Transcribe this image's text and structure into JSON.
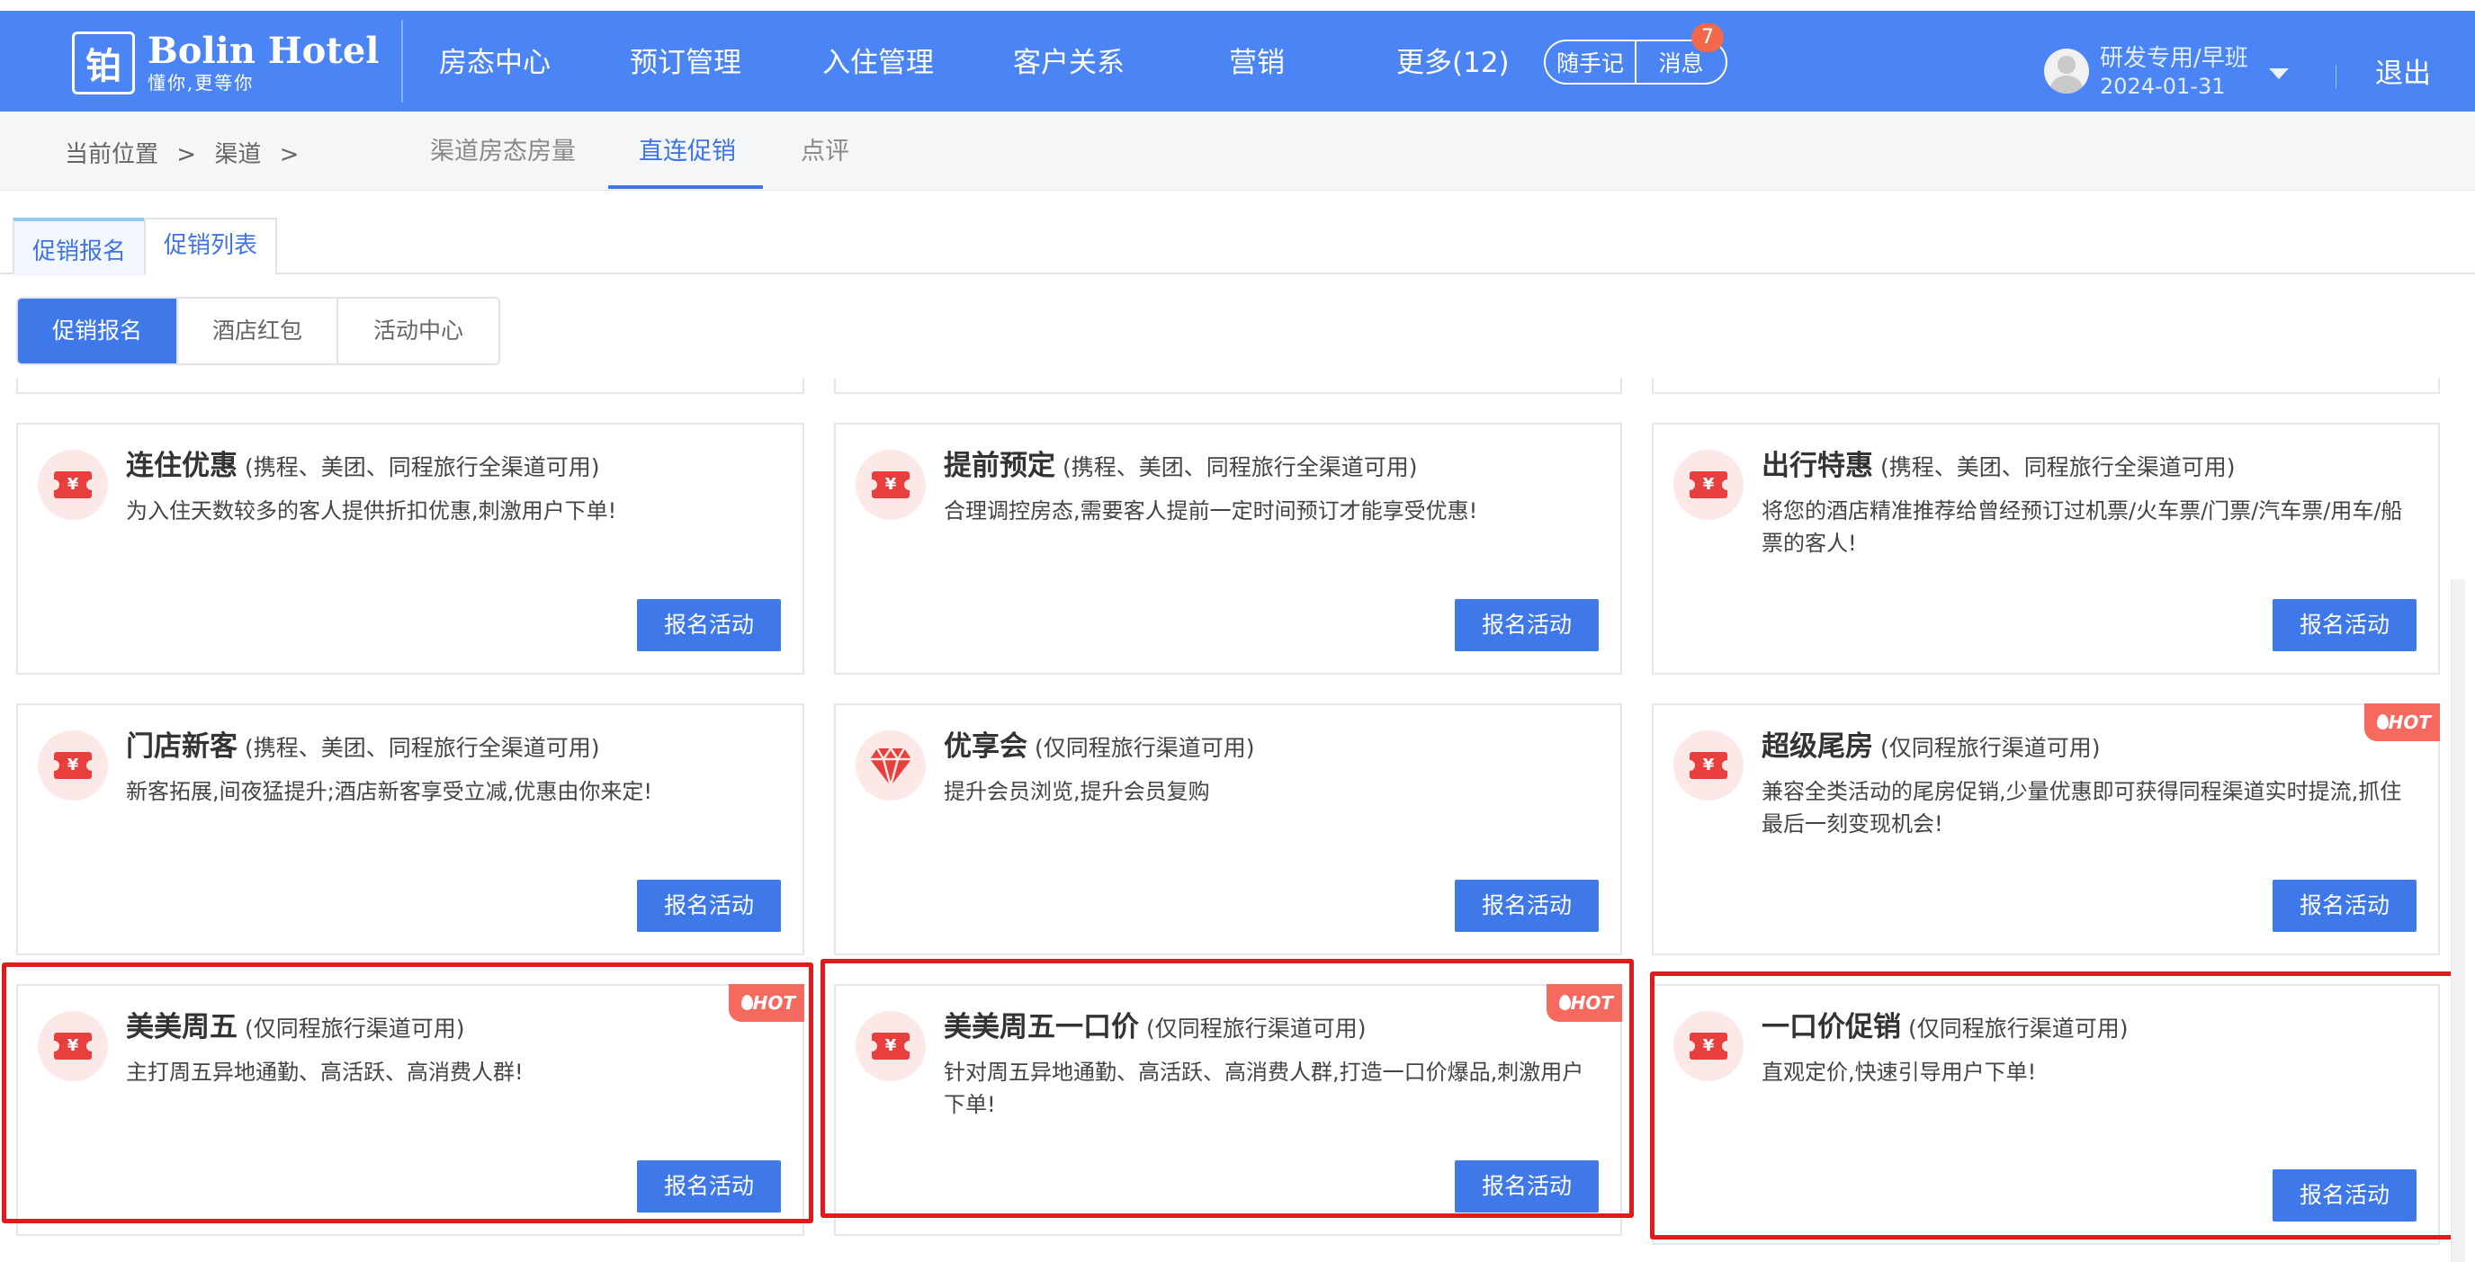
{
  "header": {
    "logo_mark": "铂",
    "logo_name": "Bolin Hotel",
    "logo_slogan": "懂你,更等你",
    "nav": [
      "房态中心",
      "预订管理",
      "入住管理",
      "客户关系",
      "营销",
      "更多(12)"
    ],
    "notes_label": "随手记",
    "messages_label": "消息",
    "messages_count": "7",
    "user_name": "研发专用/早班",
    "user_date": "2024-01-31",
    "logout_label": "退出"
  },
  "breadcrumb": [
    "当前位置",
    ">",
    "渠道",
    ">"
  ],
  "subtabs": [
    "渠道房态房量",
    "直连促销",
    "点评"
  ],
  "promo_tabs": [
    "促销报名",
    "促销列表"
  ],
  "segments": [
    "促销报名",
    "酒店红包",
    "活动中心"
  ],
  "cards": [
    {
      "title": "连住优惠",
      "scope": "(携程、美团、同程旅行全渠道可用)",
      "desc": "为入住天数较多的客人提供折扣优惠,刺激用户下单!",
      "button": "报名活动",
      "icon": "ticket-icon",
      "icon_text": "¥",
      "hot": ""
    },
    {
      "title": "提前预定",
      "scope": "(携程、美团、同程旅行全渠道可用)",
      "desc": "合理调控房态,需要客人提前一定时间预订才能享受优惠!",
      "button": "报名活动",
      "icon": "ticket-icon",
      "icon_text": "¥",
      "hot": ""
    },
    {
      "title": "出行特惠",
      "scope": "(携程、美团、同程旅行全渠道可用)",
      "desc": "将您的酒店精准推荐给曾经预订过机票/火车票/门票/汽车票/用车/船票的客人!",
      "button": "报名活动",
      "icon": "ticket-icon",
      "icon_text": "¥",
      "hot": ""
    },
    {
      "title": "门店新客",
      "scope": "(携程、美团、同程旅行全渠道可用)",
      "desc": "新客拓展,间夜猛提升;酒店新客享受立减,优惠由你来定!",
      "button": "报名活动",
      "icon": "ticket-icon",
      "icon_text": "¥",
      "hot": ""
    },
    {
      "title": "优享会",
      "scope": "(仅同程旅行渠道可用)",
      "desc": "提升会员浏览,提升会员复购",
      "button": "报名活动",
      "icon": "diamond-icon",
      "icon_text": "",
      "hot": ""
    },
    {
      "title": "超级尾房",
      "scope": "(仅同程旅行渠道可用)",
      "desc": "兼容全类活动的尾房促销,少量优惠即可获得同程渠道实时提流,抓住最后一刻变现机会!",
      "button": "报名活动",
      "icon": "ticket-icon",
      "icon_text": "¥",
      "hot": "HOT"
    },
    {
      "title": "美美周五",
      "scope": "(仅同程旅行渠道可用)",
      "desc": "主打周五异地通勤、高活跃、高消费人群!",
      "button": "报名活动",
      "icon": "ticket-icon",
      "icon_text": "¥",
      "hot": "HOT"
    },
    {
      "title": "美美周五一口价",
      "scope": "(仅同程旅行渠道可用)",
      "desc": "针对周五异地通勤、高活跃、高消费人群,打造一口价爆品,刺激用户下单!",
      "button": "报名活动",
      "icon": "ticket-icon",
      "icon_text": "¥",
      "hot": "HOT"
    },
    {
      "title": "一口价促销",
      "scope": "(仅同程旅行渠道可用)",
      "desc": "直观定价,快速引导用户下单!",
      "button": "报名活动",
      "icon": "ticket-icon",
      "icon_text": "¥",
      "hot": ""
    }
  ],
  "colors": {
    "primary": "#4a84f5",
    "button": "#3f78e9",
    "hot": "#f6695e",
    "highlight": "#e01b1b",
    "icon_red": "#e83e3e"
  }
}
